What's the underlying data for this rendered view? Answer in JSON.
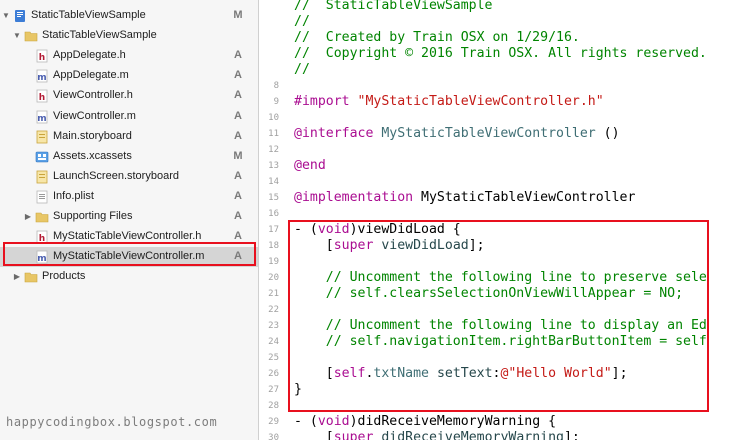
{
  "navigator": {
    "items": [
      {
        "name": "StaticTableViewSample",
        "status": "M",
        "kind": "project",
        "level": 0,
        "open": true
      },
      {
        "name": "StaticTableViewSample",
        "status": "",
        "kind": "folder",
        "level": 1,
        "open": true
      },
      {
        "name": "AppDelegate.h",
        "status": "A",
        "kind": "h",
        "level": 2
      },
      {
        "name": "AppDelegate.m",
        "status": "A",
        "kind": "m",
        "level": 2
      },
      {
        "name": "ViewController.h",
        "status": "A",
        "kind": "h",
        "level": 2
      },
      {
        "name": "ViewController.m",
        "status": "A",
        "kind": "m",
        "level": 2
      },
      {
        "name": "Main.storyboard",
        "status": "A",
        "kind": "storyboard",
        "level": 2
      },
      {
        "name": "Assets.xcassets",
        "status": "M",
        "kind": "assets",
        "level": 2
      },
      {
        "name": "LaunchScreen.storyboard",
        "status": "A",
        "kind": "storyboard",
        "level": 2
      },
      {
        "name": "Info.plist",
        "status": "A",
        "kind": "plist",
        "level": 2
      },
      {
        "name": "Supporting Files",
        "status": "A",
        "kind": "folder",
        "level": 2,
        "open": false
      },
      {
        "name": "MyStaticTableViewController.h",
        "status": "A",
        "kind": "h",
        "level": 2
      },
      {
        "name": "MyStaticTableViewController.m",
        "status": "A",
        "kind": "m",
        "level": 2,
        "selected": true
      },
      {
        "name": "Products",
        "status": "",
        "kind": "folder",
        "level": 1,
        "open": false
      }
    ]
  },
  "editor": {
    "lines": [
      {
        "num": "",
        "tokens": [
          [
            "c-comment",
            "//  StaticTableViewSample"
          ]
        ]
      },
      {
        "num": "",
        "tokens": [
          [
            "c-comment",
            "//"
          ]
        ]
      },
      {
        "num": "",
        "tokens": [
          [
            "c-comment",
            "//  Created by Train OSX on 1/29/16."
          ]
        ]
      },
      {
        "num": "",
        "tokens": [
          [
            "c-comment",
            "//  Copyright © 2016 Train OSX. All rights reserved."
          ]
        ]
      },
      {
        "num": "",
        "tokens": [
          [
            "c-comment",
            "//"
          ]
        ]
      },
      {
        "num": "8",
        "tokens": []
      },
      {
        "num": "9",
        "tokens": [
          [
            "c-kw",
            "#import "
          ],
          [
            "c-str",
            "\"MyStaticTableViewController.h\""
          ]
        ]
      },
      {
        "num": "10",
        "tokens": []
      },
      {
        "num": "11",
        "tokens": [
          [
            "c-kw",
            "@interface "
          ],
          [
            "c-cls",
            "MyStaticTableViewController"
          ],
          [
            "c-plain",
            " ()"
          ]
        ]
      },
      {
        "num": "12",
        "tokens": []
      },
      {
        "num": "13",
        "tokens": [
          [
            "c-kw",
            "@end"
          ]
        ]
      },
      {
        "num": "14",
        "tokens": []
      },
      {
        "num": "15",
        "tokens": [
          [
            "c-kw",
            "@implementation "
          ],
          [
            "c-plain",
            "MyStaticTableViewController"
          ]
        ]
      },
      {
        "num": "16",
        "tokens": []
      },
      {
        "num": "17",
        "tokens": [
          [
            "c-plain",
            "- ("
          ],
          [
            "c-kw",
            "void"
          ],
          [
            "c-plain",
            ")viewDidLoad {"
          ]
        ]
      },
      {
        "num": "18",
        "tokens": [
          [
            "c-plain",
            "    ["
          ],
          [
            "c-kw",
            "super"
          ],
          [
            "c-plain",
            " "
          ],
          [
            "c-sym",
            "viewDidLoad"
          ],
          [
            "c-plain",
            "];"
          ]
        ]
      },
      {
        "num": "19",
        "tokens": []
      },
      {
        "num": "20",
        "tokens": [
          [
            "c-comment",
            "    // Uncomment the following line to preserve sele"
          ]
        ]
      },
      {
        "num": "21",
        "tokens": [
          [
            "c-comment",
            "    // self.clearsSelectionOnViewWillAppear = NO;"
          ]
        ]
      },
      {
        "num": "22",
        "tokens": []
      },
      {
        "num": "23",
        "tokens": [
          [
            "c-comment",
            "    // Uncomment the following line to display an Ed"
          ]
        ]
      },
      {
        "num": "24",
        "tokens": [
          [
            "c-comment",
            "    // self.navigationItem.rightBarButtonItem = self"
          ]
        ]
      },
      {
        "num": "25",
        "tokens": []
      },
      {
        "num": "26",
        "tokens": [
          [
            "c-plain",
            "    ["
          ],
          [
            "c-kw",
            "self"
          ],
          [
            "c-plain",
            "."
          ],
          [
            "c-cls",
            "txtName"
          ],
          [
            "c-plain",
            " "
          ],
          [
            "c-sym",
            "setText"
          ],
          [
            "c-plain",
            ":"
          ],
          [
            "c-str",
            "@\"Hello World\""
          ],
          [
            "c-plain",
            "];"
          ]
        ]
      },
      {
        "num": "27",
        "tokens": [
          [
            "c-plain",
            "}"
          ]
        ]
      },
      {
        "num": "28",
        "tokens": []
      },
      {
        "num": "29",
        "tokens": [
          [
            "c-plain",
            "- ("
          ],
          [
            "c-kw",
            "void"
          ],
          [
            "c-plain",
            ")didReceiveMemoryWarning {"
          ]
        ]
      },
      {
        "num": "30",
        "tokens": [
          [
            "c-plain",
            "    ["
          ],
          [
            "c-kw",
            "super"
          ],
          [
            "c-plain",
            " "
          ],
          [
            "c-sym",
            "didReceiveMemoryWarning"
          ],
          [
            "c-plain",
            "];"
          ]
        ]
      }
    ]
  },
  "watermark": "happycodingbox.blogspot.com",
  "colors": {
    "highlight_red": "#e8101e",
    "comment": "#008400",
    "keyword": "#aa0d91",
    "string": "#c41a16"
  }
}
